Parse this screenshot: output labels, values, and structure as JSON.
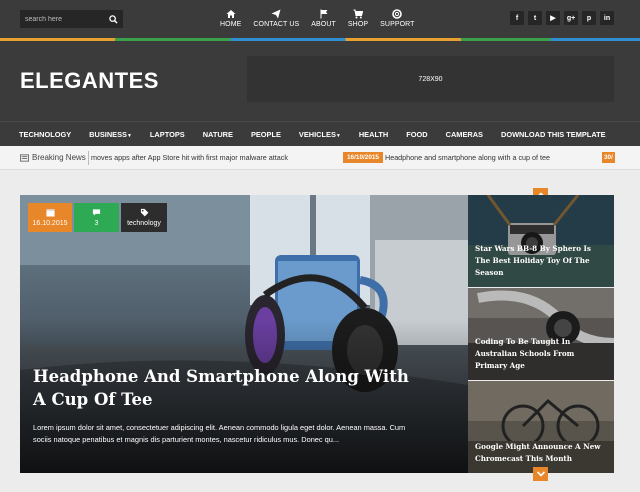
{
  "search": {
    "placeholder": "search here"
  },
  "top_nav": [
    {
      "label": "HOME",
      "icon": "home-icon"
    },
    {
      "label": "CONTACT US",
      "icon": "paper-plane-icon"
    },
    {
      "label": "ABOUT",
      "icon": "flag-icon"
    },
    {
      "label": "SHOP",
      "icon": "cart-icon"
    },
    {
      "label": "SUPPORT",
      "icon": "lifebuoy-icon"
    }
  ],
  "social": [
    {
      "glyph": "f",
      "icon": "facebook-icon"
    },
    {
      "glyph": "t",
      "icon": "twitter-icon"
    },
    {
      "glyph": "▶",
      "icon": "youtube-icon"
    },
    {
      "glyph": "g+",
      "icon": "google-plus-icon"
    },
    {
      "glyph": "p",
      "icon": "pinterest-icon"
    },
    {
      "glyph": "in",
      "icon": "linkedin-icon"
    }
  ],
  "header": {
    "logo": "ELEGANTES",
    "ad": "728X90"
  },
  "main_nav": [
    "TECHNOLOGY",
    "BUSINESS",
    "LAPTOPS",
    "NATURE",
    "PEOPLE",
    "VEHICLES",
    "HEALTH",
    "FOOD",
    "CAMERAS",
    "DOWNLOAD THIS TEMPLATE"
  ],
  "breaking": {
    "label": "Breaking News",
    "items": [
      {
        "text": "moves apps after App Store hit with first major malware attack"
      },
      {
        "date": "16/10/2015",
        "text": "Headphone and smartphone along with a cup of tee"
      },
      {
        "date": "30/"
      }
    ]
  },
  "featured": {
    "date": "16.10.2015",
    "comments": "3",
    "tag": "technology",
    "title": "Headphone And Smartphone Along With A Cup Of Tee",
    "excerpt": "Lorem ipsum dolor sit amet, consectetuer adipiscing elit. Aenean commodo ligula eget dolor. Aenean massa. Cum sociis natoque penatibus et magnis dis parturient montes, nascetur ridiculus mus. Donec qu..."
  },
  "side_posts": [
    {
      "title": "Star Wars BB-8 By Sphero Is The Best Holiday Toy Of The Season"
    },
    {
      "title": "Coding To Be Taught In Australian Schools From Primary Age"
    },
    {
      "title": "Google Might Announce A New Chromecast This Month"
    }
  ],
  "colors": {
    "accent": "#e8862a",
    "green": "#2eaa54",
    "dark": "#3b3b3b"
  }
}
